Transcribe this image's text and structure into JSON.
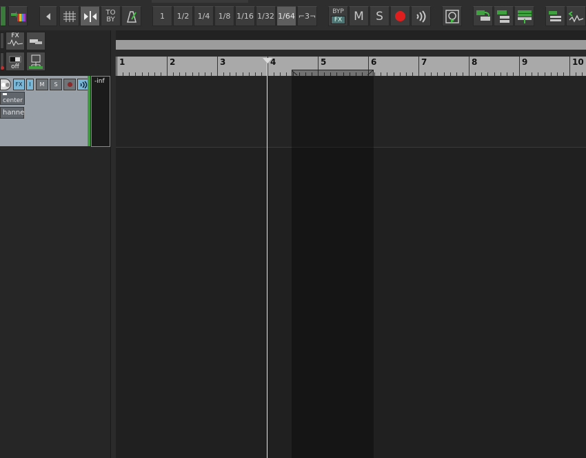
{
  "toolbar": {
    "to_by_top": "TO",
    "to_by_bottom": "BY",
    "grid_divisions": [
      "1",
      "1/2",
      "1/4",
      "1/8",
      "1/16",
      "1/32",
      "1/64",
      "⌐3¬"
    ],
    "grid_active": "1/64",
    "bypass_top": "BYP",
    "bypass_bottom": "FX",
    "mute_label": "M",
    "solo_label": "S"
  },
  "tcp_tools": {
    "fx_label": "FX",
    "off_label": "off"
  },
  "track": {
    "fx_button": "FX",
    "io_button": "I",
    "mute_button": "M",
    "solo_button": "S",
    "pan_value": "center",
    "channel_label": "hanne",
    "meter_value": "-inf"
  },
  "ruler": {
    "bars": [
      "1",
      "2",
      "3",
      "4",
      "5",
      "6",
      "7",
      "8",
      "9",
      "10"
    ]
  },
  "colors": {
    "record": "#e01e1e",
    "track_color": "#3f9a3f",
    "accent_blue": "#7bb7d6"
  }
}
